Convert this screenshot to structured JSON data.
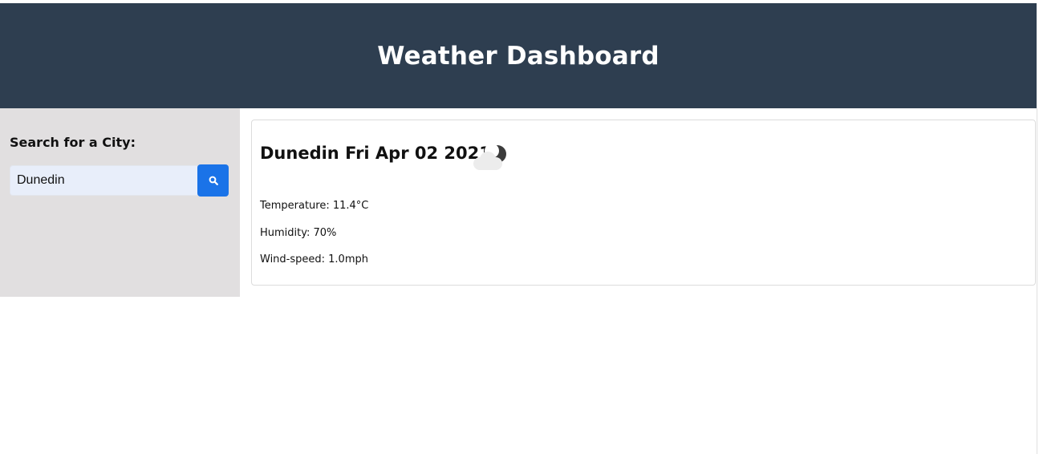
{
  "header": {
    "title": "Weather Dashboard"
  },
  "sidebar": {
    "search_label": "Search for a City:",
    "search_value": "Dunedin",
    "search_icon": "search-icon"
  },
  "current": {
    "title": "Dunedin Fri Apr 02 2021",
    "icon": "partly-cloudy-night-icon",
    "temperature": "Temperature: 11.4°C",
    "humidity": "Humidity: 70%",
    "wind": "Wind-speed: 1.0mph"
  },
  "colors": {
    "header_bg": "#2e3e50",
    "sidebar_bg": "#e1dfe0",
    "accent": "#1a73e8",
    "input_bg": "#e8eefa"
  }
}
